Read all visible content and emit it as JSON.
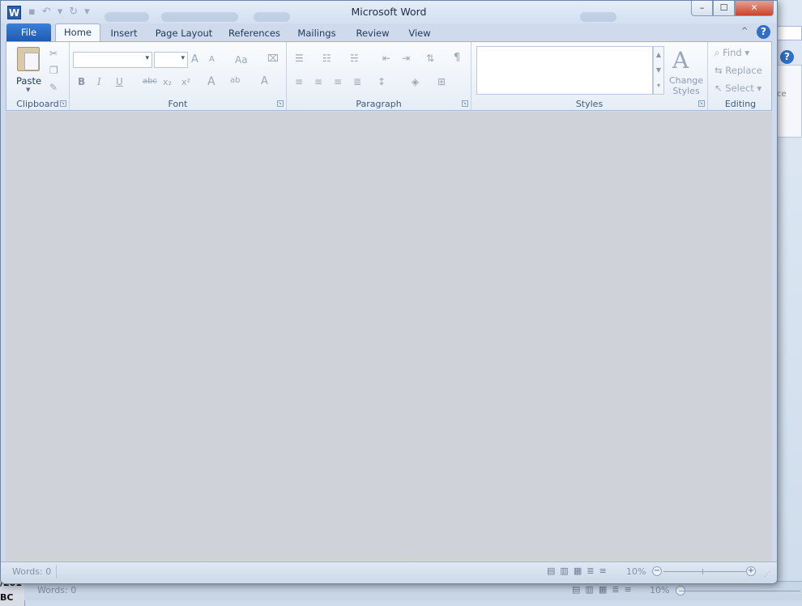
{
  "background_window": {
    "left_edge_text_1": "/201",
    "left_edge_text_2": "BC",
    "panel_fragment": "ce",
    "status_words": "Words: 0",
    "zoom": "10%"
  },
  "window": {
    "title": "Microsoft Word",
    "app_icon": "W",
    "controls": {
      "minimize": "–",
      "maximize": "☐",
      "close": "✕"
    }
  },
  "tabs": {
    "file": "File",
    "items": [
      "Home",
      "Insert",
      "Page Layout",
      "References",
      "Mailings",
      "Review",
      "View"
    ],
    "active": "Home",
    "help": "?",
    "minimize_ribbon": "^"
  },
  "ribbon": {
    "clipboard": {
      "label": "Clipboard",
      "paste": "Paste"
    },
    "font": {
      "label": "Font",
      "grow": "A",
      "shrink": "A",
      "change_case": "Aa",
      "bold": "B",
      "italic": "I",
      "underline": "U",
      "strike": "abc",
      "subscript": "x₂",
      "superscript": "x²",
      "highlight": "ab",
      "font_color": "A"
    },
    "paragraph": {
      "label": "Paragraph",
      "pilcrow": "¶"
    },
    "styles": {
      "label": "Styles",
      "change_styles_line1": "Change",
      "change_styles_line2": "Styles"
    },
    "editing": {
      "label": "Editing",
      "find": "Find",
      "replace": "Replace",
      "select": "Select"
    }
  },
  "statusbar": {
    "words": "Words: 0",
    "zoom": "10%"
  }
}
